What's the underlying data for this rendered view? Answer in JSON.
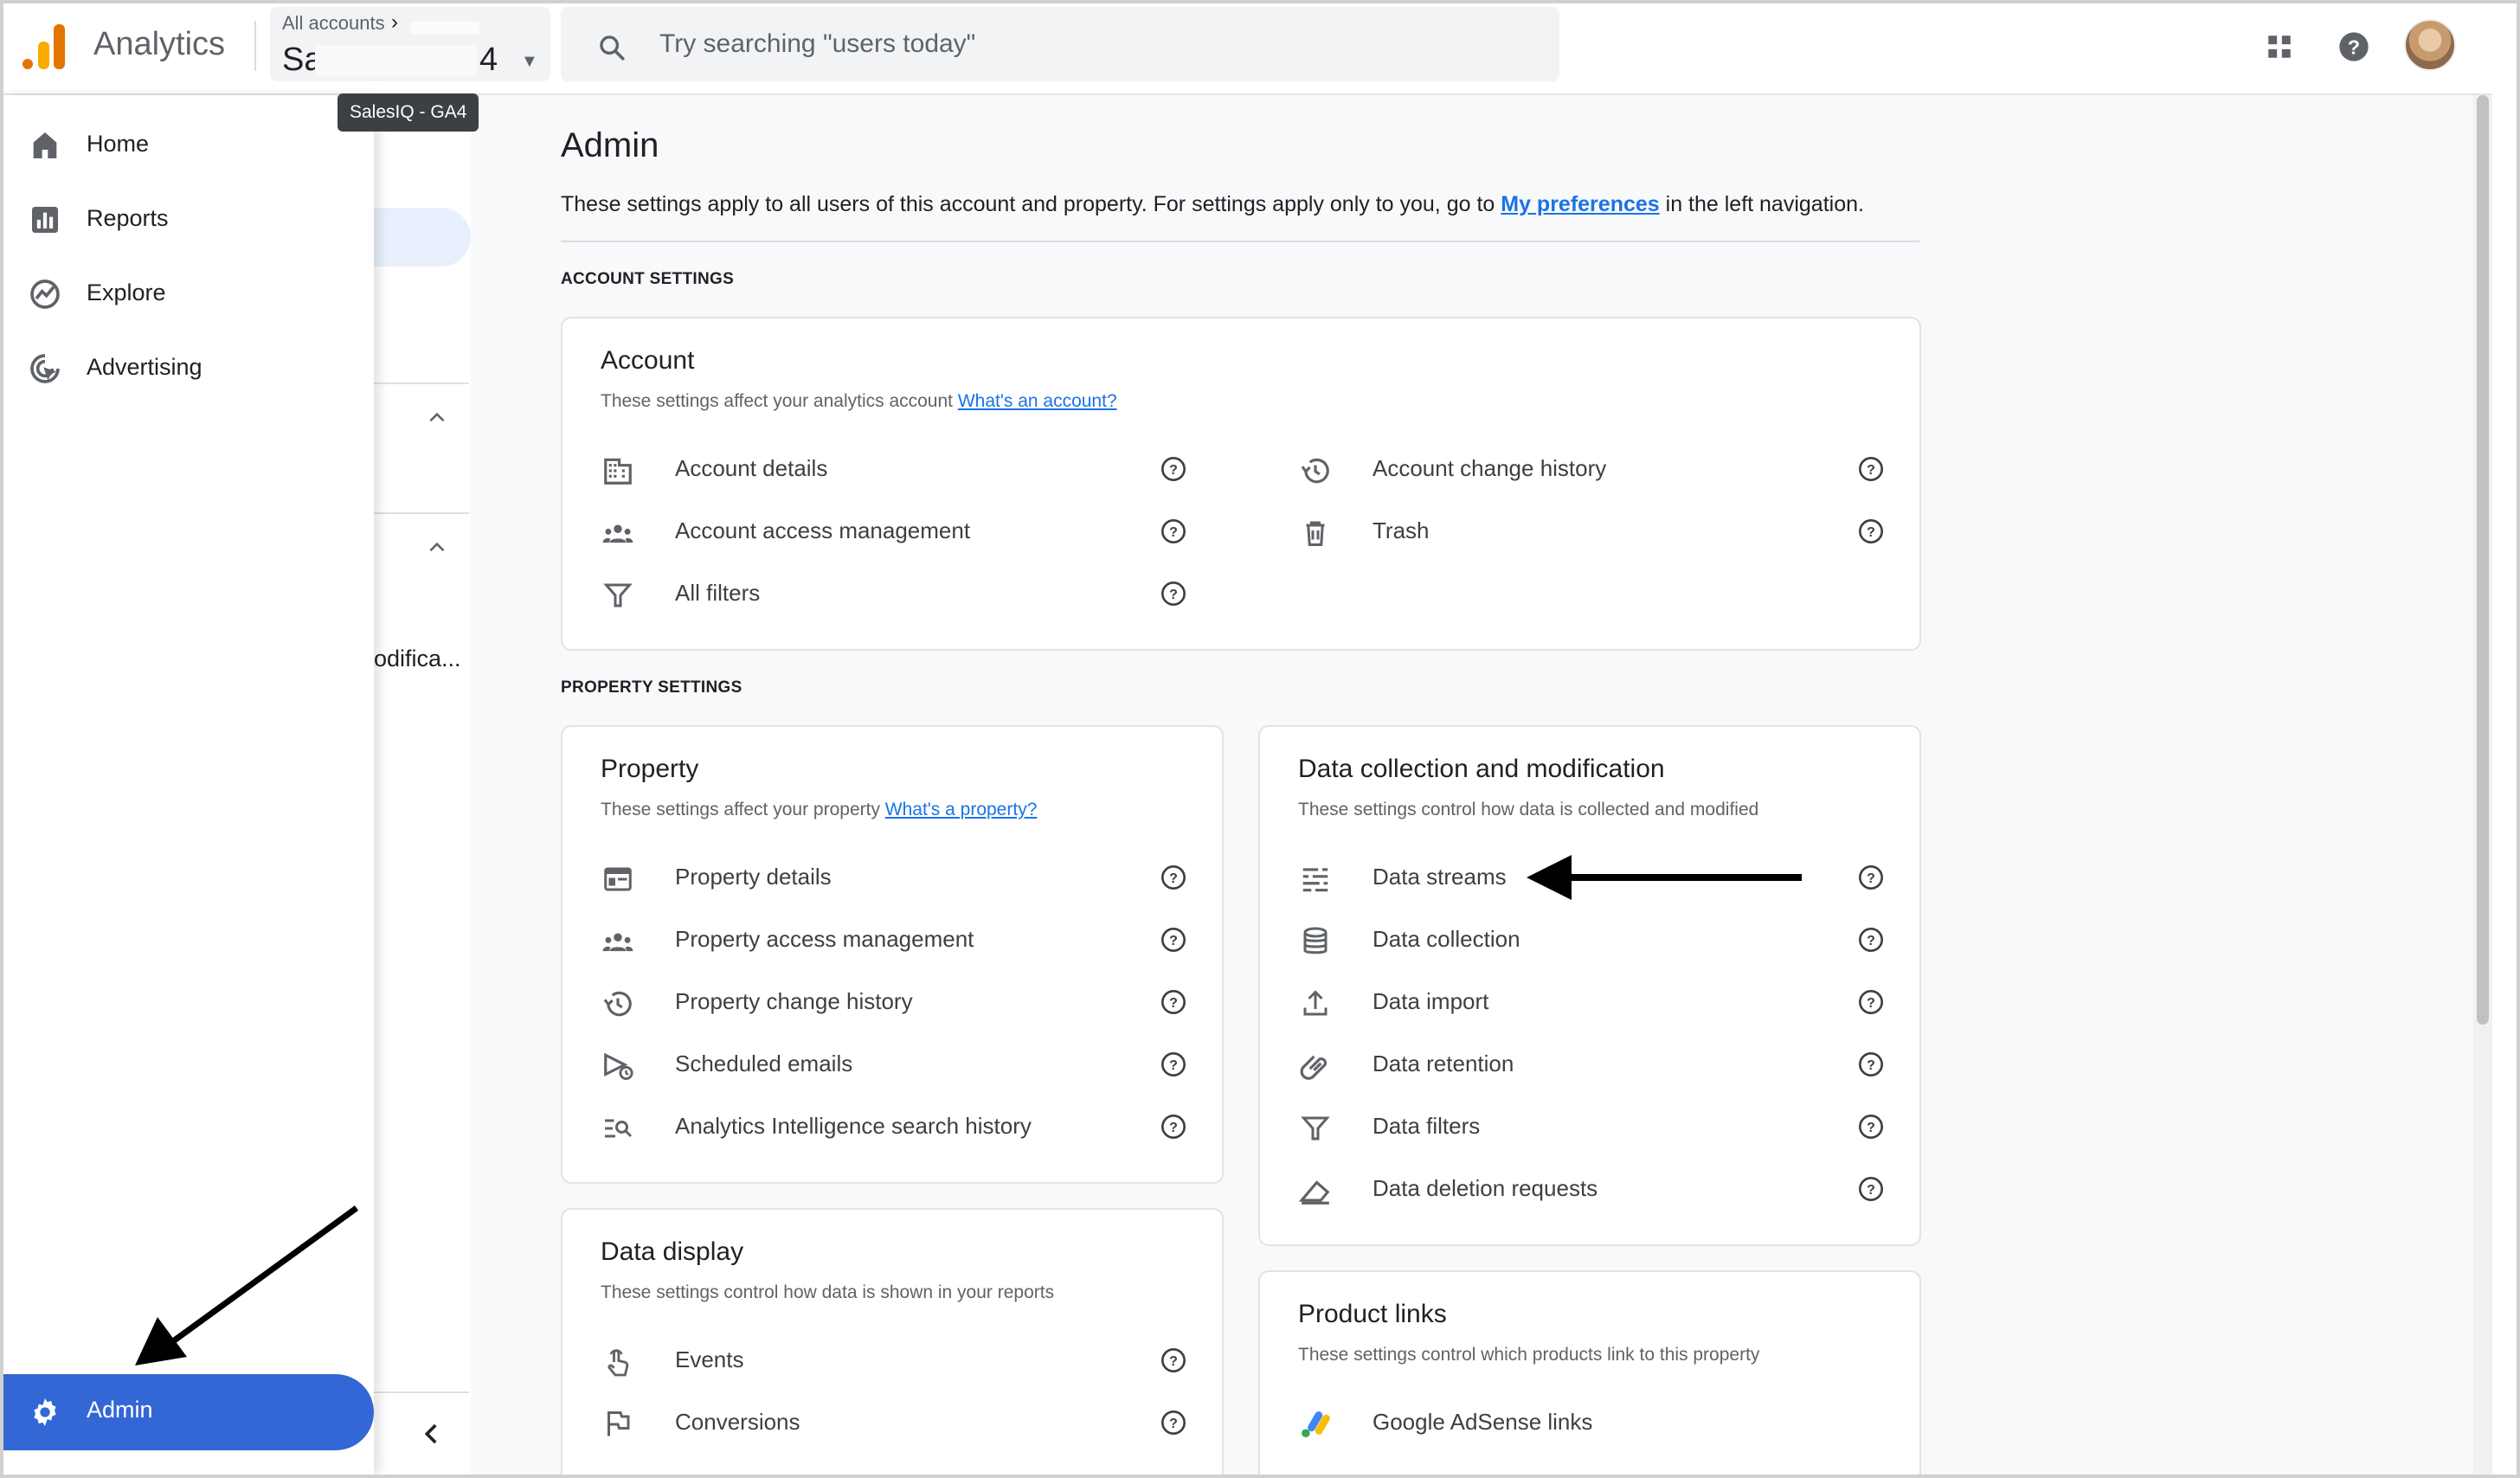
{
  "header": {
    "app_name": "Analytics",
    "account_crumb": "All accounts",
    "property_name_start": "Sa",
    "property_name_end": "4",
    "property_tooltip": "SalesIQ - GA4",
    "search_placeholder": "Try searching \"users today\""
  },
  "leftnav": {
    "items": [
      {
        "label": "Home",
        "icon": "home-icon"
      },
      {
        "label": "Reports",
        "icon": "reports-icon"
      },
      {
        "label": "Explore",
        "icon": "explore-icon"
      },
      {
        "label": "Advertising",
        "icon": "advertising-icon"
      }
    ],
    "admin_label": "Admin"
  },
  "subnav": {
    "cut_text": "odifica..."
  },
  "page": {
    "title": "Admin",
    "desc_before": "These settings apply to all users of this account and property. For settings apply only to you, go to ",
    "desc_link": "My preferences",
    "desc_after": " in the left navigation.",
    "account_section": "ACCOUNT SETTINGS",
    "property_section": "PROPERTY SETTINGS"
  },
  "account_card": {
    "title": "Account",
    "subtitle": "These settings affect your analytics account ",
    "subtitle_link": "What's an account?",
    "left_items": [
      "Account details",
      "Account access management",
      "All filters"
    ],
    "right_items": [
      "Account change history",
      "Trash"
    ]
  },
  "property_card": {
    "title": "Property",
    "subtitle": "These settings affect your property ",
    "subtitle_link": "What's a property?",
    "items": [
      "Property details",
      "Property access management",
      "Property change history",
      "Scheduled emails",
      "Analytics Intelligence search history"
    ]
  },
  "data_collection_card": {
    "title": "Data collection and modification",
    "subtitle": "These settings control how data is collected and modified",
    "items": [
      "Data streams",
      "Data collection",
      "Data import",
      "Data retention",
      "Data filters",
      "Data deletion requests"
    ]
  },
  "data_display_card": {
    "title": "Data display",
    "subtitle": "These settings control how data is shown in your reports",
    "items": [
      "Events",
      "Conversions"
    ]
  },
  "product_links_card": {
    "title": "Product links",
    "subtitle": "These settings control which products link to this property",
    "items": [
      "Google AdSense links"
    ]
  },
  "colors": {
    "accent": "#1a73e8",
    "admin_active": "#3367d6",
    "logo_orange": "#e37400",
    "logo_yellow": "#f9ab00"
  }
}
